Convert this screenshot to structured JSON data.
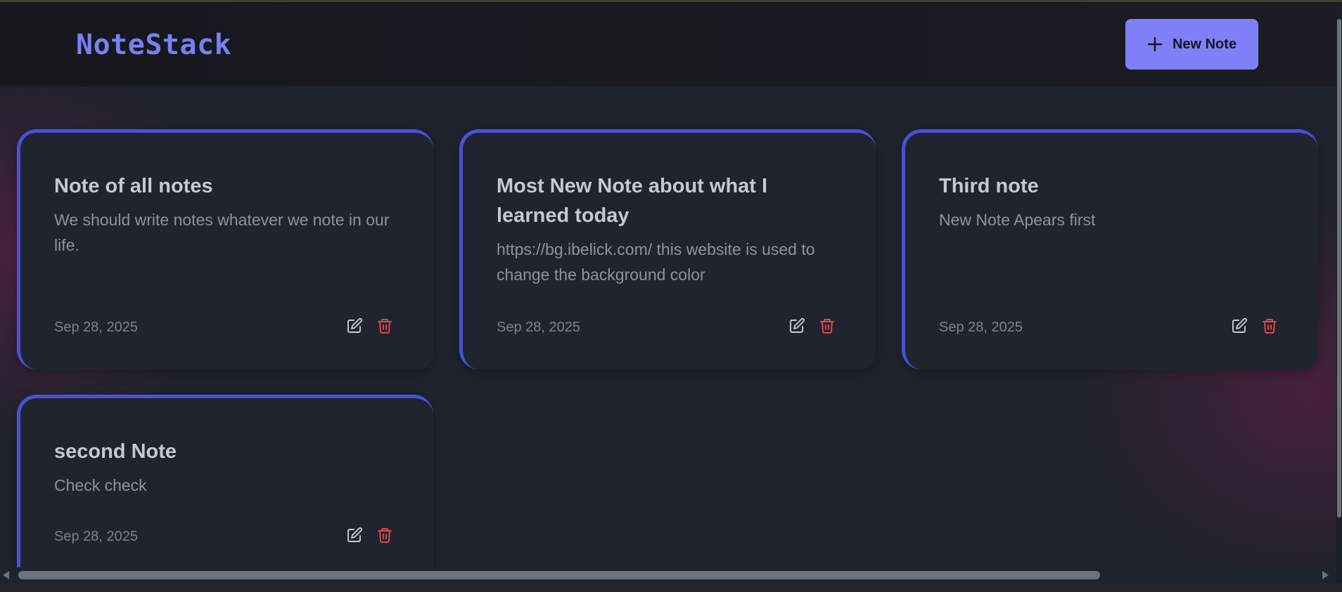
{
  "app": {
    "title": "NoteStack"
  },
  "toolbar": {
    "new_note_label": "New Note",
    "new_note_icon": "plus-icon"
  },
  "colors": {
    "accent": "#7f80f8",
    "card_border": "#4c4fd6",
    "delete": "#e5484d",
    "logo": "#7b7ff2"
  },
  "notes": [
    {
      "title": "Note of all notes",
      "body": "We should write notes whatever we note in our life.",
      "date": "Sep 28, 2025",
      "edit_icon": "edit-icon",
      "delete_icon": "trash-icon"
    },
    {
      "title": "Most New Note about what I learned today",
      "body": "https://bg.ibelick.com/ this website is used to change the background color",
      "date": "Sep 28, 2025",
      "edit_icon": "edit-icon",
      "delete_icon": "trash-icon"
    },
    {
      "title": "Third note",
      "body": "New Note Apears first",
      "date": "Sep 28, 2025",
      "edit_icon": "edit-icon",
      "delete_icon": "trash-icon"
    },
    {
      "title": "second Note",
      "body": "Check check",
      "date": "Sep 28, 2025",
      "edit_icon": "edit-icon",
      "delete_icon": "trash-icon"
    }
  ]
}
